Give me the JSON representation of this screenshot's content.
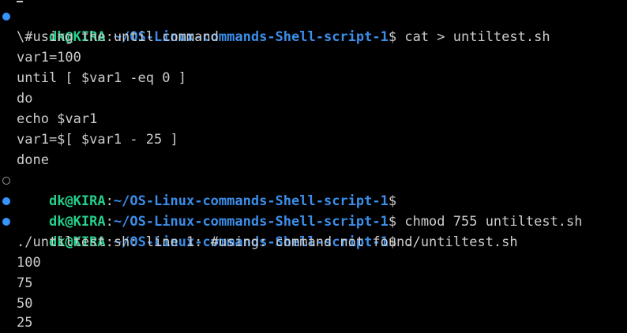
{
  "prompt": {
    "user": "dk@KIRA",
    "sep": ":",
    "path": "~/OS-Linux-commands-Shell-script-1",
    "sigil": "$"
  },
  "lines": {
    "l1_cmd": " cat > untiltest.sh",
    "l2": "\\#using the until command",
    "l3": "var1=100",
    "l4": "until [ $var1 -eq 0 ]",
    "l5": "do",
    "l6": "echo $var1",
    "l7": "var1=$[ $var1 - 25 ]",
    "l8": "done",
    "l9_cmd": "",
    "l10_cmd": " chmod 755 untiltest.sh",
    "l11_cmd": " ./untiltest.sh",
    "l12": "./untiltest.sh: line 1: #using: command not found",
    "l13": "100",
    "l14": "75",
    "l15": "50",
    "l16": "25"
  },
  "colors": {
    "background": "#000000",
    "text": "#cccccc",
    "user": "#23d18b",
    "path": "#3b8eea",
    "decoration_success": "#3794ff",
    "decoration_default": "#9a9a9a"
  }
}
